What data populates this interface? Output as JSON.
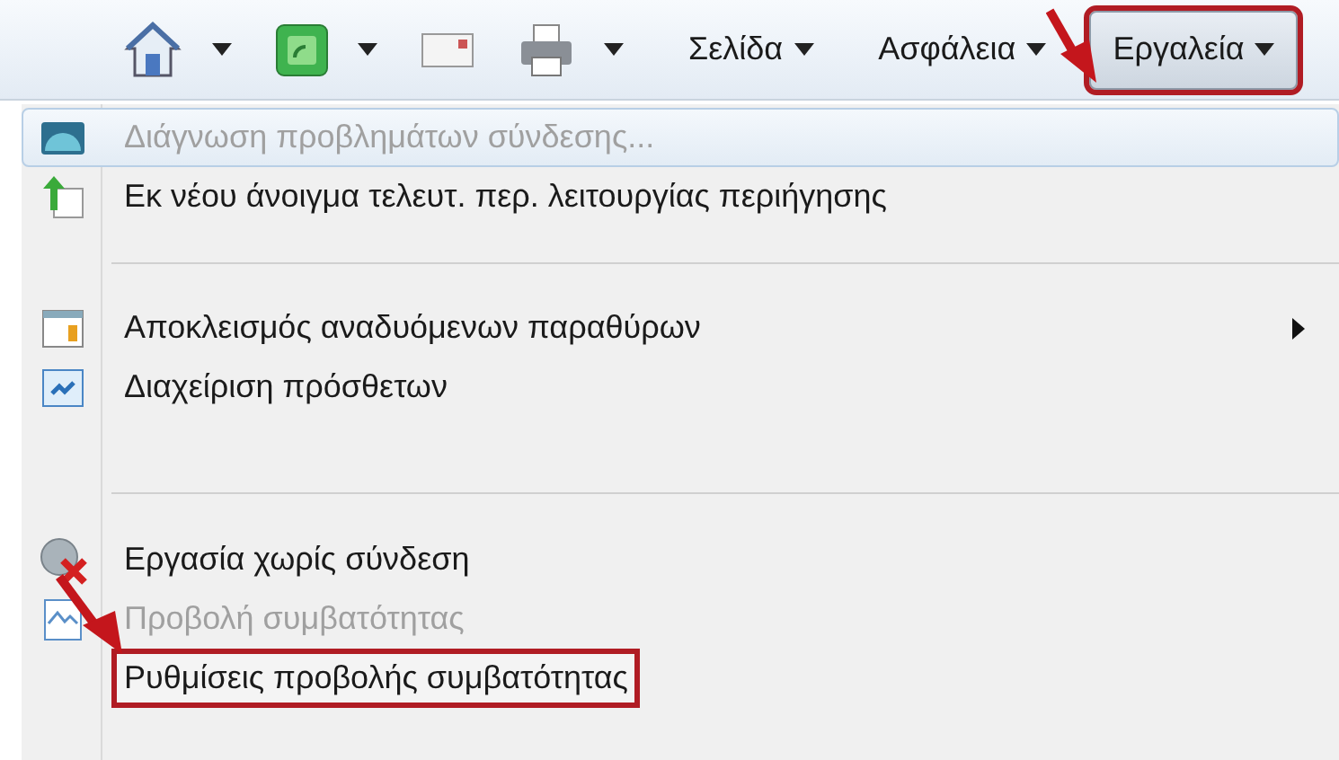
{
  "toolbar": {
    "items": [
      {
        "kind": "icon",
        "dropdown": true
      },
      {
        "kind": "icon",
        "dropdown": true
      },
      {
        "kind": "icon",
        "dropdown": false
      },
      {
        "kind": "icon",
        "dropdown": true
      },
      {
        "kind": "menu",
        "label": "Σελίδα",
        "selected": false,
        "outlined": false
      },
      {
        "kind": "menu",
        "label": "Ασφάλεια",
        "selected": false,
        "outlined": false
      },
      {
        "kind": "menu",
        "label": "Εργαλεία",
        "selected": true,
        "outlined": true
      }
    ]
  },
  "menu": {
    "items": [
      {
        "kind": "item",
        "label": "Διάγνωση προβλημάτων σύνδεσης...",
        "disabled": true,
        "selected": true,
        "submenu": false,
        "outlined": false
      },
      {
        "kind": "item",
        "label": "Εκ νέου άνοιγμα τελευτ. περ. λειτουργίας περιήγησης",
        "disabled": false,
        "selected": false,
        "submenu": false,
        "outlined": false
      },
      {
        "kind": "separator"
      },
      {
        "kind": "item",
        "label": "Αποκλεισμός αναδυόμενων παραθύρων",
        "disabled": false,
        "selected": false,
        "submenu": true,
        "outlined": false
      },
      {
        "kind": "item",
        "label": "Διαχείριση πρόσθετων",
        "disabled": false,
        "selected": false,
        "submenu": false,
        "outlined": false
      },
      {
        "kind": "separator"
      },
      {
        "kind": "item",
        "label": "Εργασία χωρίς σύνδεση",
        "disabled": false,
        "selected": false,
        "submenu": false,
        "outlined": false
      },
      {
        "kind": "item",
        "label": "Προβολή συμβατότητας",
        "disabled": true,
        "selected": false,
        "submenu": false,
        "outlined": false
      },
      {
        "kind": "item",
        "label": "Ρυθμίσεις προβολής συμβατότητας",
        "disabled": false,
        "selected": false,
        "submenu": false,
        "outlined": true
      }
    ]
  }
}
